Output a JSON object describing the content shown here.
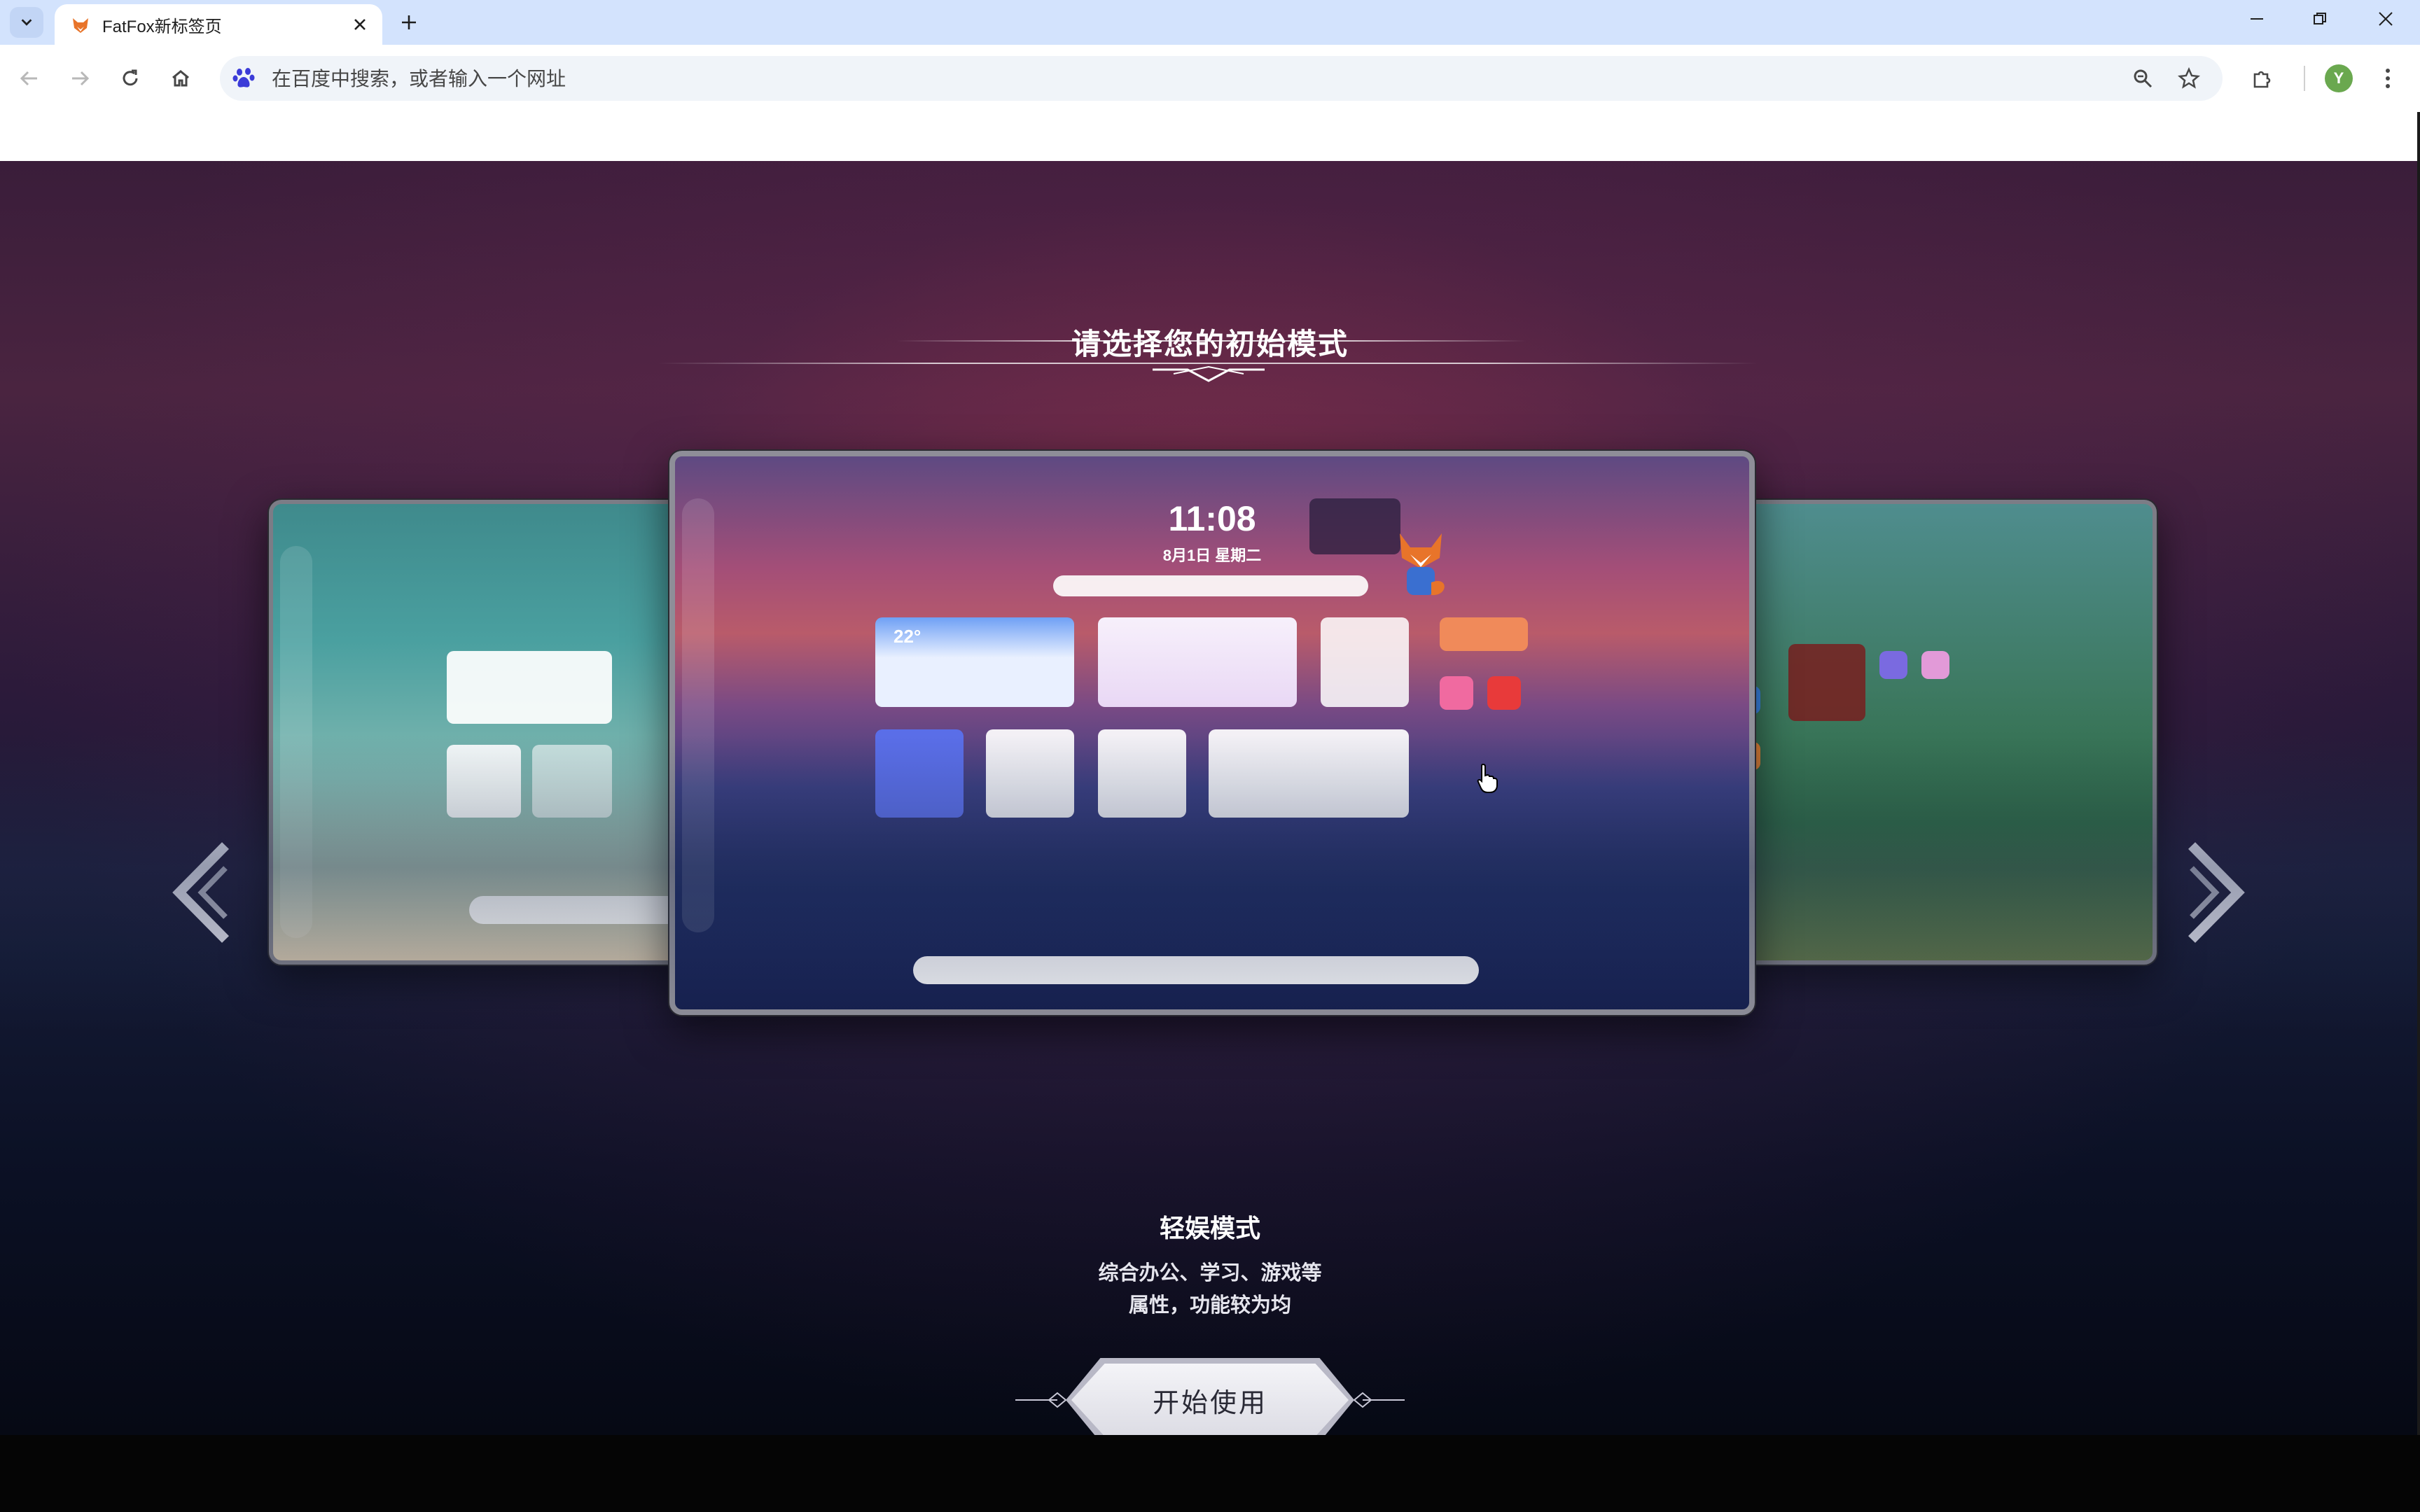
{
  "browser": {
    "tab": {
      "title": "FatFox新标签页"
    },
    "omnibox": {
      "placeholder": "在百度中搜索，或者输入一个网址"
    },
    "profile_initial": "Y",
    "icons": {
      "tab_list": "chevron-down-icon",
      "back": "arrow-left-icon",
      "forward": "arrow-right-icon",
      "reload": "reload-icon",
      "home": "home-icon",
      "search_engine": "baidu-paw-icon",
      "zoom": "zoom-icon",
      "bookmark": "star-icon",
      "extensions": "puzzle-icon",
      "menu": "kebab-menu-icon"
    }
  },
  "page": {
    "title": "请选择您的初始模式",
    "current_mode": {
      "name": "轻娱模式",
      "description_line1": "综合办公、学习、游戏等",
      "description_line2": "属性，功能较为均"
    },
    "start_button": "开始使用",
    "preview": {
      "clock": "11:08",
      "date": "8月1日 星期二",
      "weather_temp": "22°"
    }
  },
  "colors": {
    "tab_strip": "#d3e3fd",
    "omnibox_bg": "#f0f4f9",
    "page_bg_top": "#3a1d3a",
    "page_bg_bottom": "#060914",
    "accent_text": "#ffffff"
  }
}
